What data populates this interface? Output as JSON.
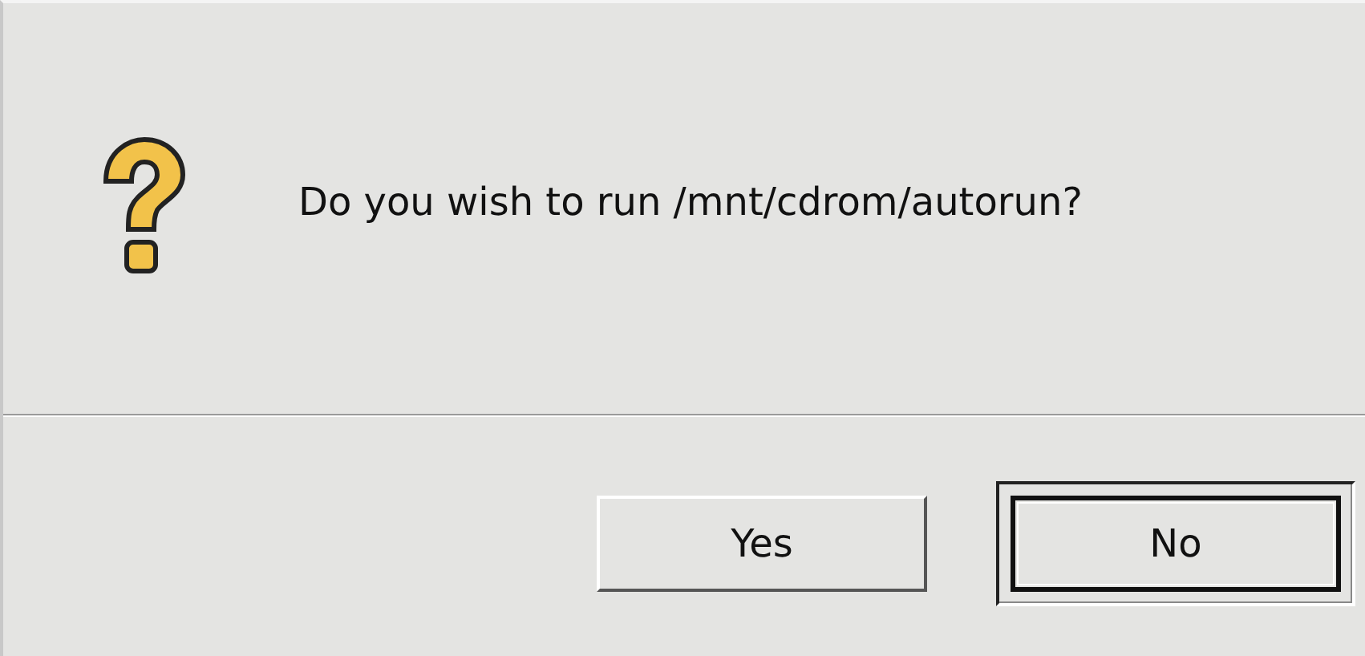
{
  "dialog": {
    "message": "Do you wish to run /mnt/cdrom/autorun?"
  },
  "buttons": [
    {
      "label": "Yes",
      "default": false
    },
    {
      "label": "No",
      "default": true
    }
  ]
}
